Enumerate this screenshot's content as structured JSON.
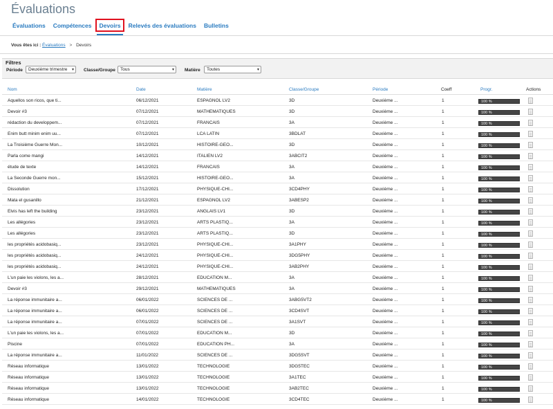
{
  "page": {
    "title": "Évaluations"
  },
  "tabs": [
    {
      "label": "Évaluations",
      "active": false
    },
    {
      "label": "Compétences",
      "active": false
    },
    {
      "label": "Devoirs",
      "active": true
    },
    {
      "label": "Relevés des évaluations",
      "active": false
    },
    {
      "label": "Bulletins",
      "active": false
    }
  ],
  "breadcrumb": {
    "lead": "Vous êtes ici :",
    "link": "Évaluations",
    "separator": ">",
    "current": "Devoirs"
  },
  "filters": {
    "title": "Filtres",
    "periode_label": "Période",
    "periode_value": "Deuxième trimestre",
    "classe_label": "Classe/Groupe",
    "classe_value": "Tous",
    "matiere_label": "Matière",
    "matiere_value": "Toutes"
  },
  "table": {
    "headers": {
      "nom": "Nom",
      "date": "Date",
      "matiere": "Matière",
      "classe": "Classe/Groupe",
      "periode": "Période",
      "coeff": "Coeff",
      "progr": "Progr.",
      "actions": "Actions"
    },
    "rows": [
      {
        "nom": "Aquellos son ricos, que ti...",
        "date": "06/12/2021",
        "matiere": "ESPAGNOL LV2",
        "classe": "3D",
        "periode": "Deuxième ...",
        "coeff": "1",
        "progr": "100 %"
      },
      {
        "nom": "Devoir #3",
        "date": "07/12/2021",
        "matiere": "MATHEMATIQUES",
        "classe": "3D",
        "periode": "Deuxième ...",
        "coeff": "1",
        "progr": "100 %"
      },
      {
        "nom": "rédaction du developpem...",
        "date": "07/12/2021",
        "matiere": "FRANCAIS",
        "classe": "3A",
        "periode": "Deuxième ...",
        "coeff": "1",
        "progr": "100 %"
      },
      {
        "nom": "Enim butt minim enim uu...",
        "date": "07/12/2021",
        "matiere": "LCA LATIN",
        "classe": "3BDLAT",
        "periode": "Deuxième ...",
        "coeff": "1",
        "progr": "100 %"
      },
      {
        "nom": "La Troisième Guerre Mon...",
        "date": "10/12/2021",
        "matiere": "HISTOIRE-GEO...",
        "classe": "3D",
        "periode": "Deuxième ...",
        "coeff": "1",
        "progr": "100 %"
      },
      {
        "nom": "Parla come mangi",
        "date": "14/12/2021",
        "matiere": "ITALIEN LV2",
        "classe": "3ABCIT2",
        "periode": "Deuxième ...",
        "coeff": "1",
        "progr": "100 %"
      },
      {
        "nom": "étude de texte",
        "date": "14/12/2021",
        "matiere": "FRANCAIS",
        "classe": "3A",
        "periode": "Deuxième ...",
        "coeff": "1",
        "progr": "100 %"
      },
      {
        "nom": "La Seconde Guerre mon...",
        "date": "15/12/2021",
        "matiere": "HISTOIRE-GEO...",
        "classe": "3A",
        "periode": "Deuxième ...",
        "coeff": "1",
        "progr": "100 %"
      },
      {
        "nom": "Dissolution",
        "date": "17/12/2021",
        "matiere": "PHYSIQUE-CHI...",
        "classe": "3CD4PHY",
        "periode": "Deuxième ...",
        "coeff": "1",
        "progr": "100 %"
      },
      {
        "nom": "Mata el gusanillo",
        "date": "21/12/2021",
        "matiere": "ESPAGNOL LV2",
        "classe": "3ABESP2",
        "periode": "Deuxième ...",
        "coeff": "1",
        "progr": "100 %"
      },
      {
        "nom": "Elvis has left the building",
        "date": "23/12/2021",
        "matiere": "ANGLAIS LV1",
        "classe": "3D",
        "periode": "Deuxième ...",
        "coeff": "1",
        "progr": "100 %"
      },
      {
        "nom": "Les allégories",
        "date": "23/12/2021",
        "matiere": "ARTS PLASTIQ...",
        "classe": "3A",
        "periode": "Deuxième ...",
        "coeff": "1",
        "progr": "100 %"
      },
      {
        "nom": "Les allégories",
        "date": "23/12/2021",
        "matiere": "ARTS PLASTIQ...",
        "classe": "3D",
        "periode": "Deuxième ...",
        "coeff": "1",
        "progr": "100 %"
      },
      {
        "nom": "les propriétés acidobasiq...",
        "date": "23/12/2021",
        "matiere": "PHYSIQUE-CHI...",
        "classe": "3A1PHY",
        "periode": "Deuxième ...",
        "coeff": "1",
        "progr": "100 %"
      },
      {
        "nom": "les propriétés acidobasiq...",
        "date": "24/12/2021",
        "matiere": "PHYSIQUE-CHI...",
        "classe": "3DG5PHY",
        "periode": "Deuxième ...",
        "coeff": "1",
        "progr": "100 %"
      },
      {
        "nom": "les propriétés acidobasiq...",
        "date": "24/12/2021",
        "matiere": "PHYSIQUE-CHI...",
        "classe": "3AB2PHY",
        "periode": "Deuxième ...",
        "coeff": "1",
        "progr": "100 %"
      },
      {
        "nom": "L'un paie les violons, les a...",
        "date": "28/12/2021",
        "matiere": "EDUCATION M...",
        "classe": "3A",
        "periode": "Deuxième ...",
        "coeff": "1",
        "progr": "100 %"
      },
      {
        "nom": "Devoir #3",
        "date": "29/12/2021",
        "matiere": "MATHEMATIQUES",
        "classe": "3A",
        "periode": "Deuxième ...",
        "coeff": "1",
        "progr": "100 %"
      },
      {
        "nom": "La réponse immunitaire a...",
        "date": "06/01/2022",
        "matiere": "SCIENCES DE ...",
        "classe": "3ABG5VT2",
        "periode": "Deuxième ...",
        "coeff": "1",
        "progr": "100 %"
      },
      {
        "nom": "La réponse immunitaire a...",
        "date": "06/01/2022",
        "matiere": "SCIENCES DE ...",
        "classe": "3CD4SVT",
        "periode": "Deuxième ...",
        "coeff": "1",
        "progr": "100 %"
      },
      {
        "nom": "La réponse immunitaire a...",
        "date": "07/01/2022",
        "matiere": "SCIENCES DE ...",
        "classe": "3A1SVT",
        "periode": "Deuxième ...",
        "coeff": "1",
        "progr": "100 %"
      },
      {
        "nom": "L'un paie les violons, les a...",
        "date": "07/01/2022",
        "matiere": "EDUCATION M...",
        "classe": "3D",
        "periode": "Deuxième ...",
        "coeff": "1",
        "progr": "100 %"
      },
      {
        "nom": "Piscine",
        "date": "07/01/2022",
        "matiere": "EDUCATION PH...",
        "classe": "3A",
        "periode": "Deuxième ...",
        "coeff": "1",
        "progr": "100 %"
      },
      {
        "nom": "La réponse immunitaire a...",
        "date": "11/01/2022",
        "matiere": "SCIENCES DE ...",
        "classe": "3DG5SVT",
        "periode": "Deuxième ...",
        "coeff": "1",
        "progr": "100 %"
      },
      {
        "nom": "Réseau informatique",
        "date": "13/01/2022",
        "matiere": "TECHNOLOGIE",
        "classe": "3DG5TEC",
        "periode": "Deuxième ...",
        "coeff": "1",
        "progr": "100 %"
      },
      {
        "nom": "Réseau informatique",
        "date": "13/01/2022",
        "matiere": "TECHNOLOGIE",
        "classe": "3A1TEC",
        "periode": "Deuxième ...",
        "coeff": "1",
        "progr": "100 %"
      },
      {
        "nom": "Réseau informatique",
        "date": "13/01/2022",
        "matiere": "TECHNOLOGIE",
        "classe": "3AB2TEC",
        "periode": "Deuxième ...",
        "coeff": "1",
        "progr": "100 %"
      },
      {
        "nom": "Réseau informatique",
        "date": "14/01/2022",
        "matiere": "TECHNOLOGIE",
        "classe": "3CD4TEC",
        "periode": "Deuxième ...",
        "coeff": "1",
        "progr": "100 %"
      }
    ]
  }
}
